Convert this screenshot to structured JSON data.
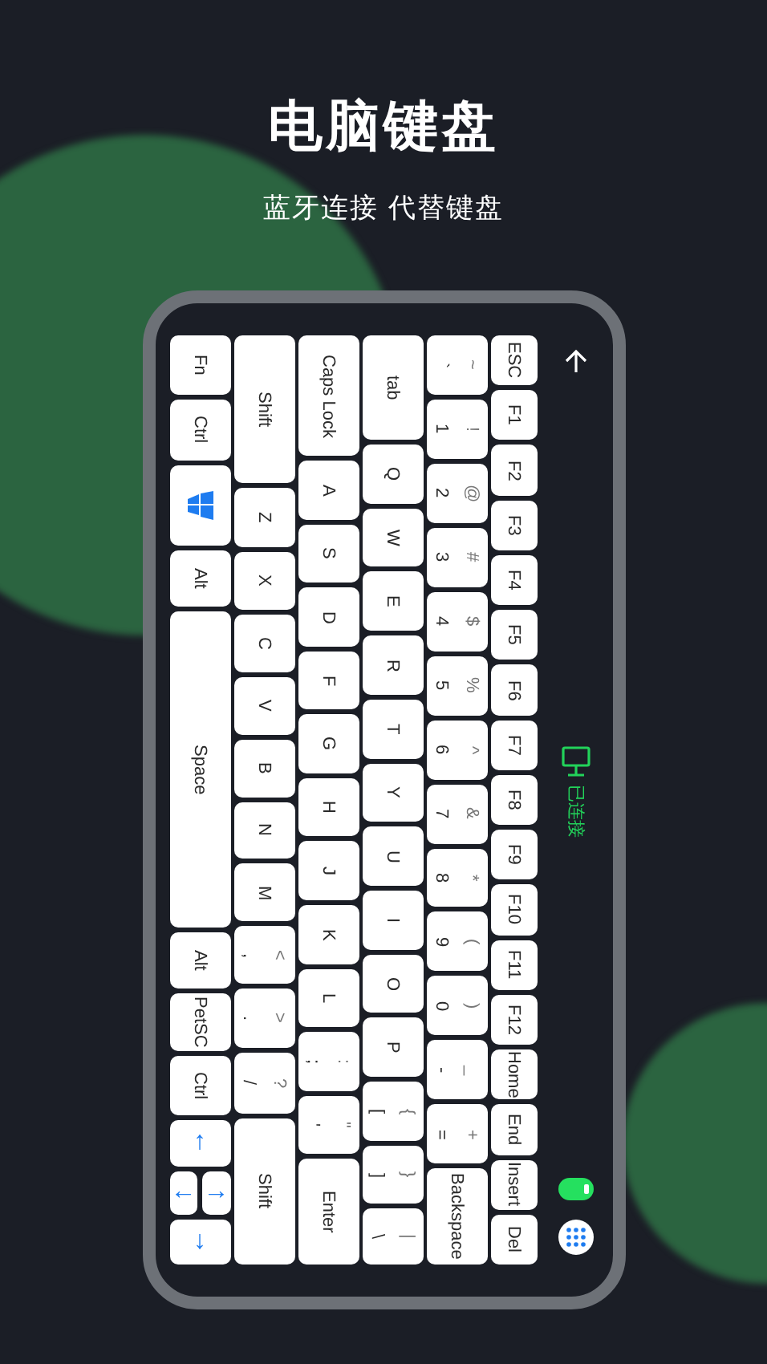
{
  "header": {
    "title": "电脑键盘",
    "subtitle": "蓝牙连接 代替键盘"
  },
  "keyboard": {
    "columns": [
      {
        "keys": [
          {
            "kind": "text",
            "label": "Fn"
          },
          {
            "kind": "text",
            "label": "Ctrl"
          },
          {
            "kind": "windows"
          },
          {
            "kind": "text",
            "label": "Alt"
          },
          {
            "kind": "text",
            "label": "Space"
          },
          {
            "kind": "text",
            "label": "Alt"
          },
          {
            "kind": "text",
            "label": "PetSC"
          },
          {
            "kind": "text",
            "label": "Ctrl"
          },
          {
            "kind": "arrow",
            "label": "↑"
          },
          {
            "kind": "pair",
            "keys": [
              {
                "label": "←"
              },
              {
                "label": "→"
              }
            ]
          },
          {
            "kind": "arrow",
            "label": "↓"
          }
        ]
      },
      {
        "keys": [
          {
            "kind": "text",
            "label": "Shift"
          },
          {
            "kind": "text",
            "label": "Z"
          },
          {
            "kind": "text",
            "label": "X"
          },
          {
            "kind": "text",
            "label": "C"
          },
          {
            "kind": "text",
            "label": "V"
          },
          {
            "kind": "text",
            "label": "B"
          },
          {
            "kind": "text",
            "label": "N"
          },
          {
            "kind": "text",
            "label": "M"
          },
          {
            "kind": "dual",
            "label": ",",
            "shift": "<"
          },
          {
            "kind": "dual",
            "label": ".",
            "shift": ">"
          },
          {
            "kind": "dual",
            "label": "/",
            "shift": "?"
          },
          {
            "kind": "text",
            "label": "Shift"
          }
        ]
      },
      {
        "keys": [
          {
            "kind": "text",
            "label": "Caps Lock"
          },
          {
            "kind": "text",
            "label": "A"
          },
          {
            "kind": "text",
            "label": "S"
          },
          {
            "kind": "text",
            "label": "D"
          },
          {
            "kind": "text",
            "label": "F"
          },
          {
            "kind": "text",
            "label": "G"
          },
          {
            "kind": "text",
            "label": "H"
          },
          {
            "kind": "text",
            "label": "J"
          },
          {
            "kind": "text",
            "label": "K"
          },
          {
            "kind": "text",
            "label": "L"
          },
          {
            "kind": "dual",
            "label": ";",
            "shift": ":"
          },
          {
            "kind": "dual",
            "label": "'",
            "shift": "\""
          },
          {
            "kind": "text",
            "label": "Enter"
          }
        ]
      },
      {
        "keys": [
          {
            "kind": "text",
            "label": "tab"
          },
          {
            "kind": "text",
            "label": "Q"
          },
          {
            "kind": "text",
            "label": "W"
          },
          {
            "kind": "text",
            "label": "E"
          },
          {
            "kind": "text",
            "label": "R"
          },
          {
            "kind": "text",
            "label": "T"
          },
          {
            "kind": "text",
            "label": "Y"
          },
          {
            "kind": "text",
            "label": "U"
          },
          {
            "kind": "text",
            "label": "I"
          },
          {
            "kind": "text",
            "label": "O"
          },
          {
            "kind": "text",
            "label": "P"
          },
          {
            "kind": "dual",
            "label": "[",
            "shift": "{"
          },
          {
            "kind": "dual",
            "label": "]",
            "shift": "}"
          },
          {
            "kind": "dual",
            "label": "\\",
            "shift": "|"
          }
        ]
      },
      {
        "keys": [
          {
            "kind": "dual",
            "label": "`",
            "shift": "~"
          },
          {
            "kind": "dual",
            "label": "1",
            "shift": "!"
          },
          {
            "kind": "dual",
            "label": "2",
            "shift": "@"
          },
          {
            "kind": "dual",
            "label": "3",
            "shift": "#"
          },
          {
            "kind": "dual",
            "label": "4",
            "shift": "$"
          },
          {
            "kind": "dual",
            "label": "5",
            "shift": "%"
          },
          {
            "kind": "dual",
            "label": "6",
            "shift": "^"
          },
          {
            "kind": "dual",
            "label": "7",
            "shift": "&"
          },
          {
            "kind": "dual",
            "label": "8",
            "shift": "*"
          },
          {
            "kind": "dual",
            "label": "9",
            "shift": "("
          },
          {
            "kind": "dual",
            "label": "0",
            "shift": ")"
          },
          {
            "kind": "dual",
            "label": "-",
            "shift": "_"
          },
          {
            "kind": "dual",
            "label": "=",
            "shift": "+"
          },
          {
            "kind": "text",
            "label": "Backspace"
          }
        ]
      },
      {
        "keys": [
          {
            "kind": "text",
            "label": "ESC"
          },
          {
            "kind": "text",
            "label": "F1"
          },
          {
            "kind": "text",
            "label": "F2"
          },
          {
            "kind": "text",
            "label": "F3"
          },
          {
            "kind": "text",
            "label": "F4"
          },
          {
            "kind": "text",
            "label": "F5"
          },
          {
            "kind": "text",
            "label": "F6"
          },
          {
            "kind": "text",
            "label": "F7"
          },
          {
            "kind": "text",
            "label": "F8"
          },
          {
            "kind": "text",
            "label": "F9"
          },
          {
            "kind": "text",
            "label": "F10"
          },
          {
            "kind": "text",
            "label": "F11"
          },
          {
            "kind": "text",
            "label": "F12"
          },
          {
            "kind": "text",
            "label": "Home"
          },
          {
            "kind": "text",
            "label": "End"
          },
          {
            "kind": "text",
            "label": "Insert"
          },
          {
            "kind": "text",
            "label": "Del"
          }
        ]
      }
    ]
  },
  "side": {
    "status": "已连接",
    "toggle": {
      "on": true
    }
  }
}
